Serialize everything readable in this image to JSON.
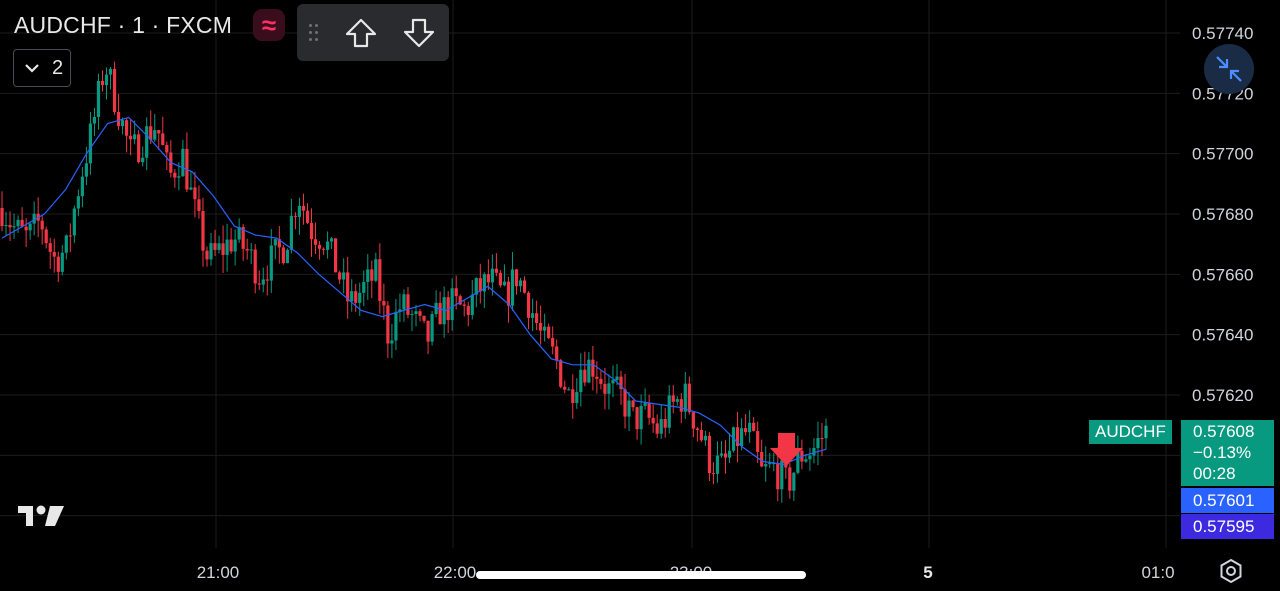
{
  "header": {
    "symbol_title": "AUDCHF · 1 · FXCM",
    "indicator_logo": "≈",
    "studies_count": "2"
  },
  "icons": {
    "up_arrow": "arrow-up-icon",
    "down_arrow": "arrow-down-icon",
    "collapse": "collapse-arrows-icon",
    "settings": "gear-icon",
    "logo": "tradingview-logo-icon"
  },
  "colors": {
    "up": "#089981",
    "down": "#f23645",
    "ma": "#2962ff",
    "grid": "#1c1c1c",
    "signal": "#f23645"
  },
  "price_labels": {
    "symbol": "AUDCHF",
    "last": "0.57608",
    "change": "−0.13%",
    "countdown": "00:28",
    "bid": "0.57601",
    "ask": "0.57595"
  },
  "chart_data": {
    "type": "candlestick",
    "y_ticks": [
      "0.57740",
      "0.57720",
      "0.57700",
      "0.57680",
      "0.57660",
      "0.57640",
      "0.57620"
    ],
    "y_tick_values": [
      0.5774,
      0.5772,
      0.577,
      0.5768,
      0.5766,
      0.5764,
      0.5762
    ],
    "ylim": [
      0.5757,
      0.57755
    ],
    "x_ticks": [
      "21:00",
      "22:00",
      "23:00",
      "5",
      "01:0"
    ],
    "close_path": [
      0.57682,
      0.57675,
      0.57672,
      0.57678,
      0.57665,
      0.57668,
      0.5769,
      0.57708,
      0.5773,
      0.57715,
      0.577,
      0.57705,
      0.5771,
      0.57692,
      0.577,
      0.5768,
      0.57665,
      0.57668,
      0.57672,
      0.57668,
      0.5766,
      0.57665,
      0.5767,
      0.57687,
      0.57675,
      0.57672,
      0.57662,
      0.5765,
      0.57655,
      0.5766,
      0.5764,
      0.5765,
      0.57645,
      0.57638,
      0.57648,
      0.5765,
      0.57648,
      0.57655,
      0.57658,
      0.57652,
      0.5766,
      0.5765,
      0.57638,
      0.57632,
      0.5762,
      0.5763,
      0.5763,
      0.57622,
      0.5762,
      0.57612,
      0.57613,
      0.57608,
      0.57616,
      0.5762,
      0.5761,
      0.57598,
      0.57596,
      0.57605,
      0.57608,
      0.57594,
      0.57596,
      0.5759,
      0.576,
      0.57602,
      0.57608
    ],
    "ma_path": [
      0.57672,
      0.57676,
      0.5768,
      0.57688,
      0.577,
      0.5771,
      0.57712,
      0.57705,
      0.57697,
      0.57694,
      0.57686,
      0.57676,
      0.57673,
      0.57672,
      0.57667,
      0.5766,
      0.57654,
      0.57648,
      0.57646,
      0.57648,
      0.5765,
      0.57648,
      0.57652,
      0.57656,
      0.5765,
      0.5764,
      0.57632,
      0.5763,
      0.5763,
      0.57625,
      0.57618,
      0.57617,
      0.57616,
      0.57614,
      0.5761,
      0.57603,
      0.57598,
      0.57597,
      0.576,
      0.57602
    ],
    "sell_signal": "down-arrow",
    "last_price": 0.57608,
    "change_pct": -0.13
  }
}
